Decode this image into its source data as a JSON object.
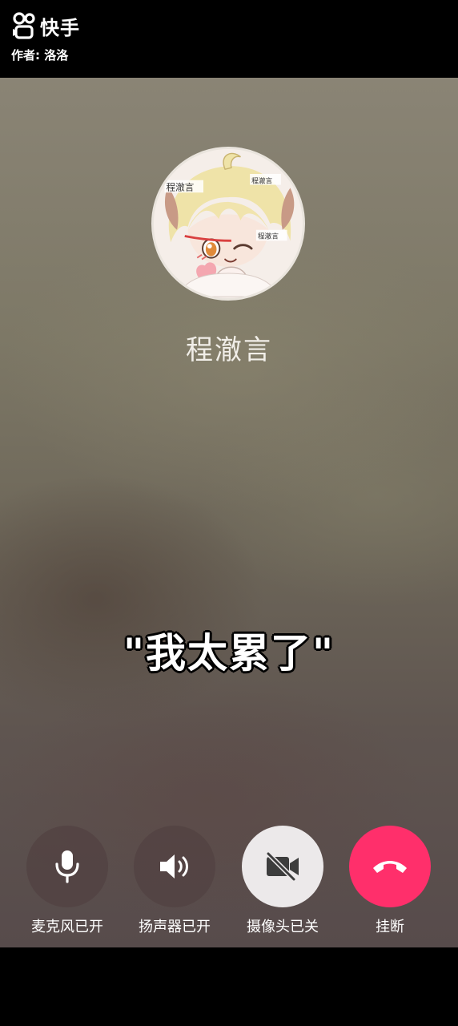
{
  "header": {
    "app_name": "快手",
    "author": "作者: 洛洛"
  },
  "call": {
    "caller_name": "程澈言",
    "avatar_tags": [
      "程澈言",
      "程澈言",
      "程澈言"
    ],
    "subtitle": "\"我太累了\""
  },
  "controls": [
    {
      "label": "麦克风已开",
      "icon": "microphone-icon",
      "state": "on"
    },
    {
      "label": "扬声器已开",
      "icon": "speaker-icon",
      "state": "on"
    },
    {
      "label": "摄像头已关",
      "icon": "camera-off-icon",
      "state": "off"
    },
    {
      "label": "挂断",
      "icon": "hang-up-icon",
      "color": "#ff2f6b"
    }
  ]
}
